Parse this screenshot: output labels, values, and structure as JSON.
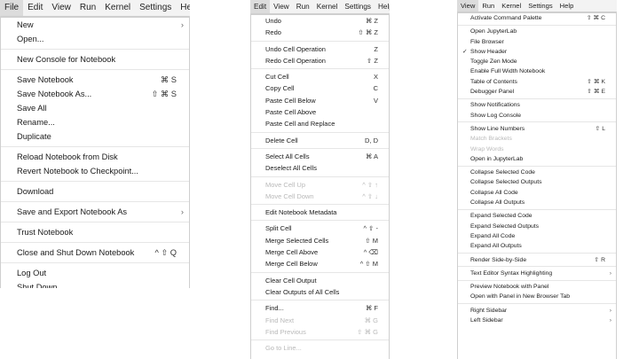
{
  "file_panel": {
    "menubar": [
      "File",
      "Edit",
      "View",
      "Run",
      "Kernel",
      "Settings",
      "Help"
    ],
    "active": 0,
    "items": [
      {
        "label": "New",
        "submenu": true
      },
      {
        "label": "Open..."
      },
      {
        "sep": true
      },
      {
        "label": "New Console for Notebook"
      },
      {
        "sep": true
      },
      {
        "label": "Save Notebook",
        "shortcut": "⌘ S"
      },
      {
        "label": "Save Notebook As...",
        "shortcut": "⇧ ⌘ S"
      },
      {
        "label": "Save All"
      },
      {
        "label": "Rename..."
      },
      {
        "label": "Duplicate"
      },
      {
        "sep": true
      },
      {
        "label": "Reload Notebook from Disk"
      },
      {
        "label": "Revert Notebook to Checkpoint..."
      },
      {
        "sep": true
      },
      {
        "label": "Download"
      },
      {
        "sep": true
      },
      {
        "label": "Save and Export Notebook As",
        "submenu": true
      },
      {
        "sep": true
      },
      {
        "label": "Trust Notebook"
      },
      {
        "sep": true
      },
      {
        "label": "Close and Shut Down Notebook",
        "shortcut": "^ ⇧ Q"
      },
      {
        "sep": true
      },
      {
        "label": "Log Out"
      },
      {
        "label": "Shut Down"
      }
    ]
  },
  "edit_panel": {
    "menubar": [
      "Edit",
      "View",
      "Run",
      "Kernel",
      "Settings",
      "Help"
    ],
    "active": 0,
    "items": [
      {
        "label": "Undo",
        "shortcut": "⌘ Z"
      },
      {
        "label": "Redo",
        "shortcut": "⇧ ⌘ Z"
      },
      {
        "sep": true
      },
      {
        "label": "Undo Cell Operation",
        "shortcut": "Z"
      },
      {
        "label": "Redo Cell Operation",
        "shortcut": "⇧ Z"
      },
      {
        "sep": true
      },
      {
        "label": "Cut Cell",
        "shortcut": "X"
      },
      {
        "label": "Copy Cell",
        "shortcut": "C"
      },
      {
        "label": "Paste Cell Below",
        "shortcut": "V"
      },
      {
        "label": "Paste Cell Above"
      },
      {
        "label": "Paste Cell and Replace"
      },
      {
        "sep": true
      },
      {
        "label": "Delete Cell",
        "shortcut": "D, D"
      },
      {
        "sep": true
      },
      {
        "label": "Select All Cells",
        "shortcut": "⌘ A"
      },
      {
        "label": "Deselect All Cells"
      },
      {
        "sep": true
      },
      {
        "label": "Move Cell Up",
        "shortcut": "^ ⇧ ↑",
        "disabled": true
      },
      {
        "label": "Move Cell Down",
        "shortcut": "^ ⇧ ↓",
        "disabled": true
      },
      {
        "sep": true
      },
      {
        "label": "Edit Notebook Metadata"
      },
      {
        "sep": true
      },
      {
        "label": "Split Cell",
        "shortcut": "^ ⇧ -"
      },
      {
        "label": "Merge Selected Cells",
        "shortcut": "⇧ M"
      },
      {
        "label": "Merge Cell Above",
        "shortcut": "^ ⌫"
      },
      {
        "label": "Merge Cell Below",
        "shortcut": "^ ⇧ M"
      },
      {
        "sep": true
      },
      {
        "label": "Clear Cell Output"
      },
      {
        "label": "Clear Outputs of All Cells"
      },
      {
        "sep": true
      },
      {
        "label": "Find...",
        "shortcut": "⌘ F"
      },
      {
        "label": "Find Next",
        "shortcut": "⌘ G",
        "disabled": true
      },
      {
        "label": "Find Previous",
        "shortcut": "⇧ ⌘ G",
        "disabled": true
      },
      {
        "sep": true
      },
      {
        "label": "Go to Line...",
        "disabled": true
      }
    ]
  },
  "view_panel": {
    "menubar": [
      "View",
      "Run",
      "Kernel",
      "Settings",
      "Help"
    ],
    "active": 0,
    "items": [
      {
        "label": "Activate Command Palette",
        "shortcut": "⇧ ⌘ C"
      },
      {
        "sep": true
      },
      {
        "label": "Open JupyterLab"
      },
      {
        "label": "File Browser"
      },
      {
        "label": "Show Header",
        "checked": true
      },
      {
        "label": "Toggle Zen Mode"
      },
      {
        "label": "Enable Full Width Notebook"
      },
      {
        "label": "Table of Contents",
        "shortcut": "⇧ ⌘ K"
      },
      {
        "label": "Debugger Panel",
        "shortcut": "⇧ ⌘ E"
      },
      {
        "sep": true
      },
      {
        "label": "Show Notifications"
      },
      {
        "label": "Show Log Console"
      },
      {
        "sep": true
      },
      {
        "label": "Show Line Numbers",
        "shortcut": "⇧ L"
      },
      {
        "label": "Match Brackets",
        "disabled": true
      },
      {
        "label": "Wrap Words",
        "disabled": true
      },
      {
        "label": "Open in JupyterLab"
      },
      {
        "sep": true
      },
      {
        "label": "Collapse Selected Code"
      },
      {
        "label": "Collapse Selected Outputs"
      },
      {
        "label": "Collapse All Code"
      },
      {
        "label": "Collapse All Outputs"
      },
      {
        "sep": true
      },
      {
        "label": "Expand Selected Code"
      },
      {
        "label": "Expand Selected Outputs"
      },
      {
        "label": "Expand All Code"
      },
      {
        "label": "Expand All Outputs"
      },
      {
        "sep": true
      },
      {
        "label": "Render Side-by-Side",
        "shortcut": "⇧ R"
      },
      {
        "sep": true
      },
      {
        "label": "Text Editor Syntax Highlighting",
        "submenu": true
      },
      {
        "sep": true
      },
      {
        "label": "Preview Notebook with Panel"
      },
      {
        "label": "Open with Panel in New Browser Tab"
      },
      {
        "sep": true
      },
      {
        "label": "Right Sidebar",
        "submenu": true
      },
      {
        "label": "Left Sidebar",
        "submenu": true
      }
    ]
  },
  "icons": {
    "submenu": "chevron-right-icon",
    "check": "check-icon"
  },
  "colors": {
    "menubar_bg": "#f3f3f3",
    "disabled_text": "#b9b9b9",
    "active_tab": "#dcdcdc"
  }
}
